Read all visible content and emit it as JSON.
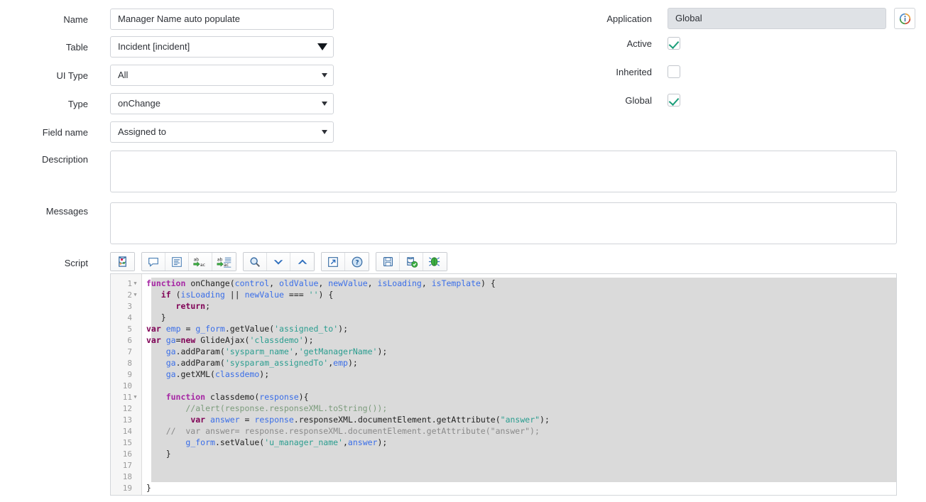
{
  "form": {
    "left_fields": [
      {
        "label": "Name",
        "type": "text",
        "value": "Manager Name auto populate"
      },
      {
        "label": "Table",
        "type": "select",
        "value": "Incident [incident]",
        "caret": "large"
      },
      {
        "label": "UI Type",
        "type": "select",
        "value": "All",
        "caret": "small"
      },
      {
        "label": "Type",
        "type": "select",
        "value": "onChange",
        "caret": "small"
      },
      {
        "label": "Field name",
        "type": "select",
        "value": "Assigned to",
        "caret": "small"
      }
    ],
    "right_fields": [
      {
        "label": "Application",
        "type": "readonly-text",
        "value": "Global"
      },
      {
        "label": "Active",
        "type": "checkbox",
        "checked": true
      },
      {
        "label": "Inherited",
        "type": "checkbox",
        "checked": false
      },
      {
        "label": "Global",
        "type": "checkbox",
        "checked": true
      }
    ],
    "info_icon": "info-circle-icon",
    "description": {
      "label": "Description",
      "value": ""
    },
    "messages": {
      "label": "Messages",
      "value": ""
    },
    "script": {
      "label": "Script"
    }
  },
  "toolbar": {
    "groups": [
      {
        "buttons": [
          {
            "name": "syntax-editor-toggle-icon",
            "title": "Toggle syntax editor"
          }
        ]
      },
      {
        "buttons": [
          {
            "name": "comment-icon",
            "title": "Comment"
          },
          {
            "name": "format-code-icon",
            "title": "Format code"
          },
          {
            "name": "replace-icon",
            "title": "Replace"
          },
          {
            "name": "replace-all-icon",
            "title": "Replace all"
          }
        ]
      },
      {
        "buttons": [
          {
            "name": "search-icon",
            "title": "Find"
          },
          {
            "name": "chevron-down-icon",
            "title": "Find next"
          },
          {
            "name": "chevron-up-icon",
            "title": "Find previous"
          }
        ]
      },
      {
        "buttons": [
          {
            "name": "fullscreen-icon",
            "title": "Toggle full screen"
          },
          {
            "name": "help-icon",
            "title": "Help"
          }
        ]
      },
      {
        "buttons": [
          {
            "name": "save-icon",
            "title": "Save"
          },
          {
            "name": "validate-script-icon",
            "title": "Validate script"
          },
          {
            "name": "debug-icon",
            "title": "Debug"
          }
        ]
      }
    ]
  },
  "code": {
    "total_lines": 19,
    "fold_lines": [
      1,
      2,
      11
    ],
    "selection_start_line": 1,
    "selection_end_line": 18,
    "lines": [
      {
        "n": 1,
        "text": "function onChange(control, oldValue, newValue, isLoading, isTemplate) {"
      },
      {
        "n": 2,
        "text": "   if (isLoading || newValue === '') {"
      },
      {
        "n": 3,
        "text": "      return;"
      },
      {
        "n": 4,
        "text": "   }"
      },
      {
        "n": 5,
        "text": "var emp = g_form.getValue('assigned_to');"
      },
      {
        "n": 6,
        "text": "var ga=new GlideAjax('classdemo');"
      },
      {
        "n": 7,
        "text": "    ga.addParam('sysparm_name','getManagerName');"
      },
      {
        "n": 8,
        "text": "    ga.addParam('sysparam_assignedTo',emp);"
      },
      {
        "n": 9,
        "text": "    ga.getXML(classdemo);"
      },
      {
        "n": 10,
        "text": ""
      },
      {
        "n": 11,
        "text": "    function classdemo(response){"
      },
      {
        "n": 12,
        "text": "        //alert(response.responseXML.toString());"
      },
      {
        "n": 13,
        "text": "         var answer = response.responseXML.documentElement.getAttribute(\"answer\");"
      },
      {
        "n": 14,
        "text": "    //  var answer= response.responseXML.documentElement.getAttribute(\"answer\");"
      },
      {
        "n": 15,
        "text": "        g_form.setValue('u_manager_name',answer);"
      },
      {
        "n": 16,
        "text": "    }"
      },
      {
        "n": 17,
        "text": ""
      },
      {
        "n": 18,
        "text": ""
      },
      {
        "n": 19,
        "text": "}"
      }
    ]
  },
  "colors": {
    "keyword": "#a626a4",
    "string": "#2a9d8f",
    "identifier_blue": "#3a6ee8",
    "comment_green": "#7c9c7c",
    "comment_gray": "#8a8a8a",
    "selection_bg": "#dadada",
    "checkbox_check": "#1c9e7a",
    "readonly_bg": "#dfe2e6"
  }
}
